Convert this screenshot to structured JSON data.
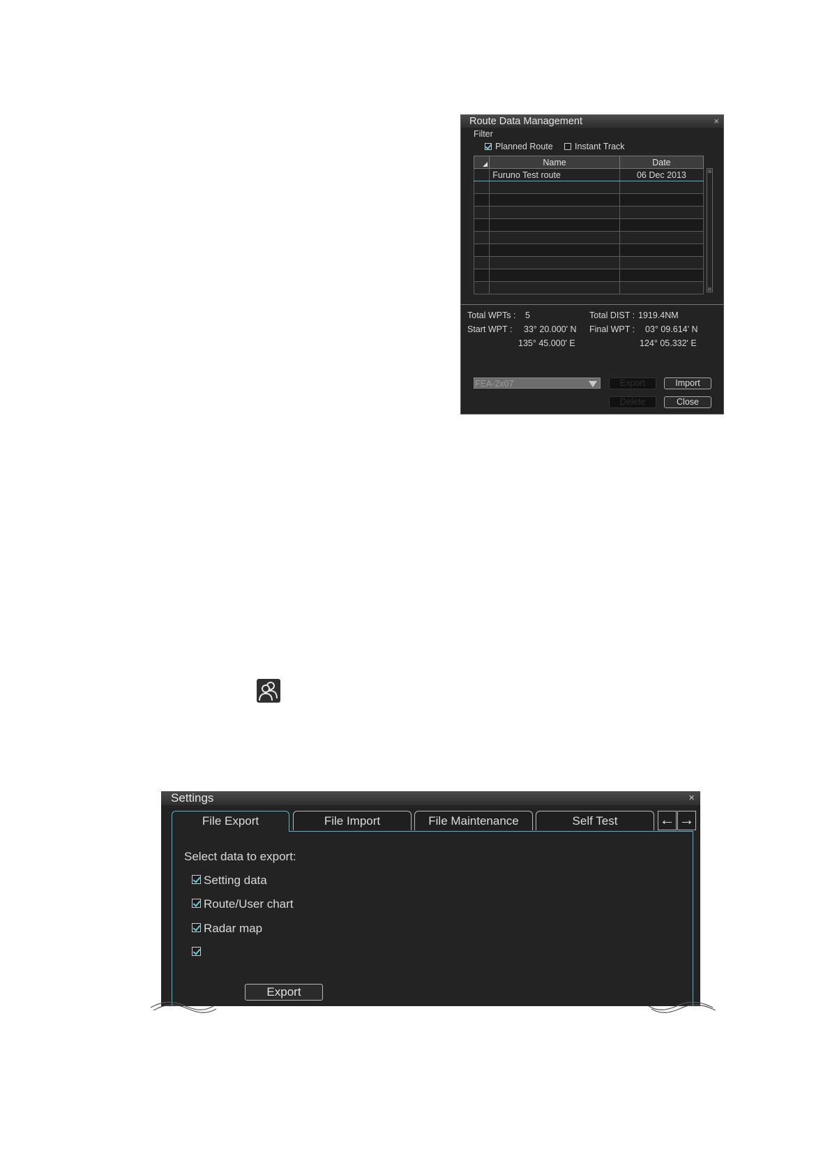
{
  "route_dialog": {
    "title": "Route Data Management",
    "close_glyph": "×",
    "filter_label": "Filter",
    "filters": [
      {
        "label": "Planned Route",
        "checked": true
      },
      {
        "label": "Instant Track",
        "checked": false
      }
    ],
    "columns": [
      "Name",
      "Date"
    ],
    "rows": [
      {
        "name": "Furuno Test route",
        "date": "06 Dec 2013"
      }
    ],
    "empty_rows": 9,
    "info": {
      "total_wpts_label": "Total WPTs :",
      "total_wpts_value": "5",
      "total_dist_label": "Total DIST :",
      "total_dist_value": "1919.4NM",
      "start_wpt_label": "Start WPT :",
      "start_wpt_lat": "33° 20.000' N",
      "start_wpt_lon": "135° 45.000' E",
      "final_wpt_label": "Final WPT :",
      "final_wpt_lat": "03° 09.614' N",
      "final_wpt_lon": "124° 05.332' E"
    },
    "device_select": "FEA-2x07",
    "buttons": {
      "export": "Export",
      "import": "Import",
      "delete": "Delete",
      "close": "Close"
    }
  },
  "toolbar_icon": "user-profile-icon",
  "settings_dialog": {
    "title": "Settings",
    "close_glyph": "×",
    "tabs": [
      "File Export",
      "File Import",
      "File Maintenance",
      "Self Test"
    ],
    "active_tab": "File Export",
    "nav_arrows": [
      "←",
      "→"
    ],
    "select_label": "Select data to export:",
    "options": [
      {
        "label": "Setting data",
        "checked": true
      },
      {
        "label": "Route/User chart",
        "checked": true
      },
      {
        "label": "Radar map",
        "checked": true
      },
      {
        "label": "",
        "checked": true
      }
    ],
    "export_button": "Export"
  },
  "colors": {
    "dialog_bg": "#232323",
    "accent": "#4fb9c9",
    "text": "#d8d8d8"
  }
}
